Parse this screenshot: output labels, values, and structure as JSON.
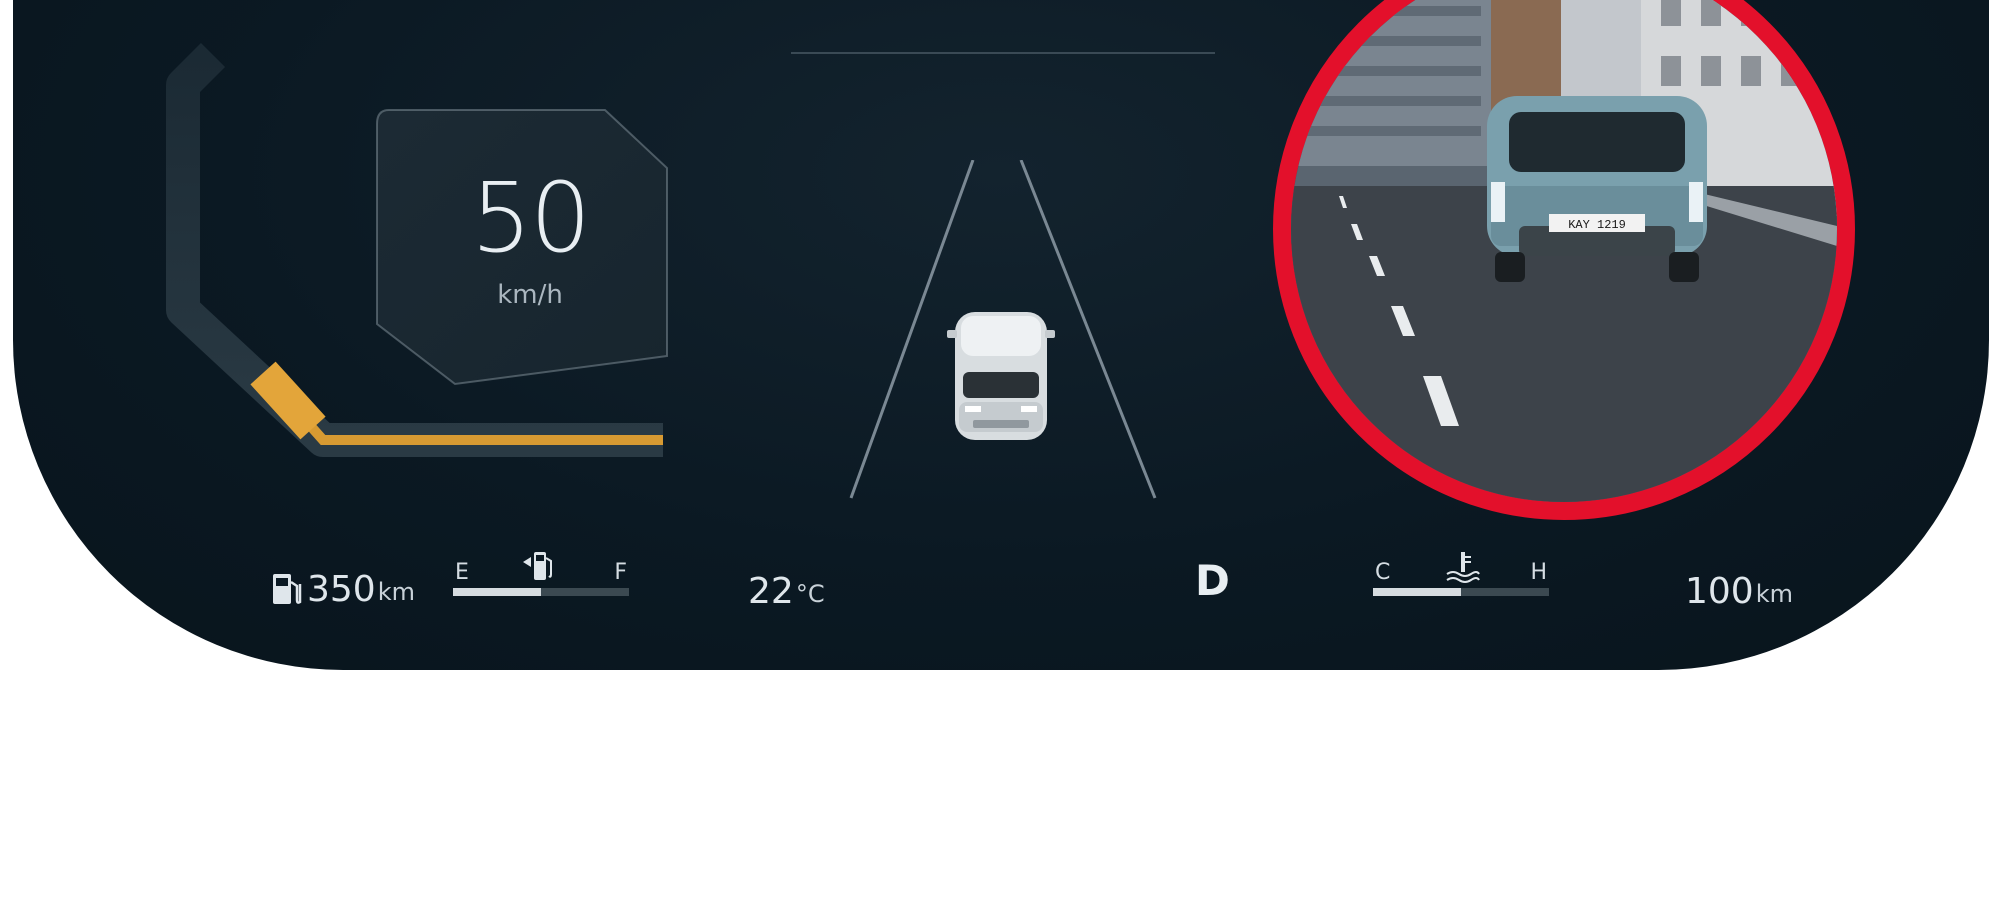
{
  "speed": {
    "value": "50",
    "unit": "km/h"
  },
  "range_left": {
    "value": "350",
    "unit": "km",
    "icon": "fuel-pump-icon"
  },
  "fuel_gauge": {
    "low_label": "E",
    "high_label": "F",
    "level": 0.5,
    "icon": "fuel-pump-icon"
  },
  "outside_temp": {
    "value": "22",
    "unit": "°C"
  },
  "gear": "D",
  "coolant_gauge": {
    "low_label": "C",
    "high_label": "H",
    "level": 0.5,
    "icon": "coolant-temperature-icon"
  },
  "range_right": {
    "value": "100",
    "unit": "km"
  },
  "camera_view": {
    "plate": "KAY 1219",
    "border_color": "#e3102b"
  },
  "colors": {
    "accent": "#e3a53a",
    "background": "#0b1923",
    "alert": "#e3102b"
  }
}
